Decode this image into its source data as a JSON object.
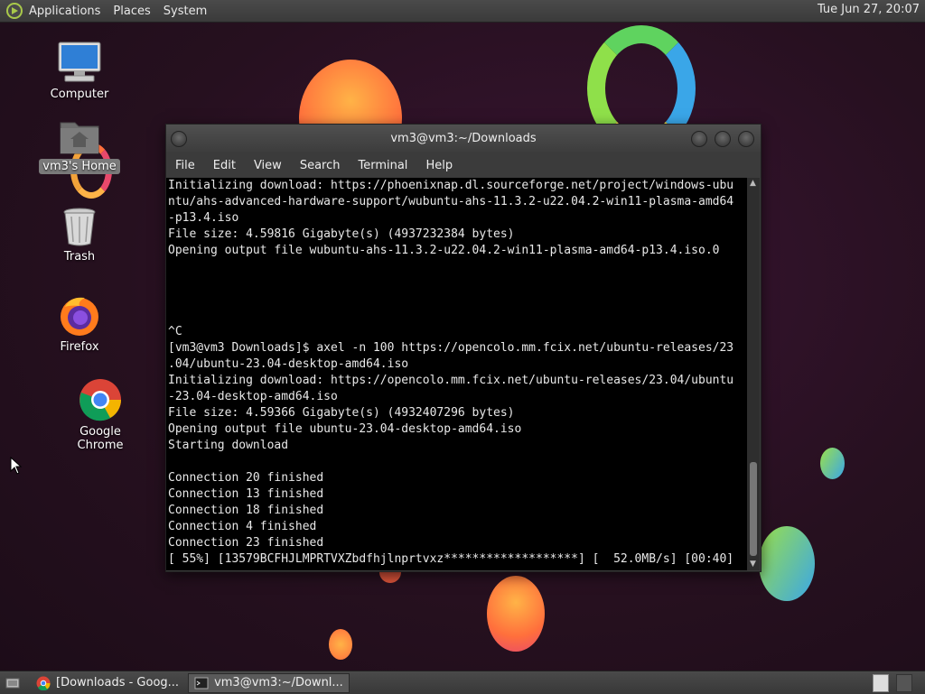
{
  "top_panel": {
    "menus": [
      "Applications",
      "Places",
      "System"
    ],
    "clock": "Tue Jun 27, 20:07"
  },
  "desktop": {
    "icons": [
      {
        "label": "Computer",
        "icon": "computer-icon"
      },
      {
        "label": "vm3's Home",
        "icon": "home-folder-icon",
        "selected": true
      },
      {
        "label": "Trash",
        "icon": "trash-icon"
      },
      {
        "label": "Firefox",
        "icon": "firefox-icon"
      },
      {
        "label": "Google Chrome",
        "icon": "chrome-icon"
      }
    ]
  },
  "terminal": {
    "title": "vm3@vm3:~/Downloads",
    "menu": [
      "File",
      "Edit",
      "View",
      "Search",
      "Terminal",
      "Help"
    ],
    "lines": [
      "Initializing download: https://phoenixnap.dl.sourceforge.net/project/windows-ubu",
      "ntu/ahs-advanced-hardware-support/wubuntu-ahs-11.3.2-u22.04.2-win11-plasma-amd64",
      "-p13.4.iso",
      "File size: 4.59816 Gigabyte(s) (4937232384 bytes)",
      "Opening output file wubuntu-ahs-11.3.2-u22.04.2-win11-plasma-amd64-p13.4.iso.0",
      "",
      "",
      "",
      "",
      "^C",
      "[vm3@vm3 Downloads]$ axel -n 100 https://opencolo.mm.fcix.net/ubuntu-releases/23",
      ".04/ubuntu-23.04-desktop-amd64.iso",
      "Initializing download: https://opencolo.mm.fcix.net/ubuntu-releases/23.04/ubuntu",
      "-23.04-desktop-amd64.iso",
      "File size: 4.59366 Gigabyte(s) (4932407296 bytes)",
      "Opening output file ubuntu-23.04-desktop-amd64.iso",
      "Starting download",
      "",
      "Connection 20 finished",
      "Connection 13 finished",
      "Connection 18 finished",
      "Connection 4 finished",
      "Connection 23 finished",
      "[ 55%] [13579BCFHJLMPRTVXZbdfhjlnprtvxz*******************] [  52.0MB/s] [00:40]"
    ]
  },
  "taskbar": {
    "tasks": [
      {
        "label": "[Downloads - Goog...",
        "icon": "chrome-icon",
        "active": false
      },
      {
        "label": "vm3@vm3:~/Downl...",
        "icon": "terminal-icon",
        "active": true
      }
    ]
  }
}
